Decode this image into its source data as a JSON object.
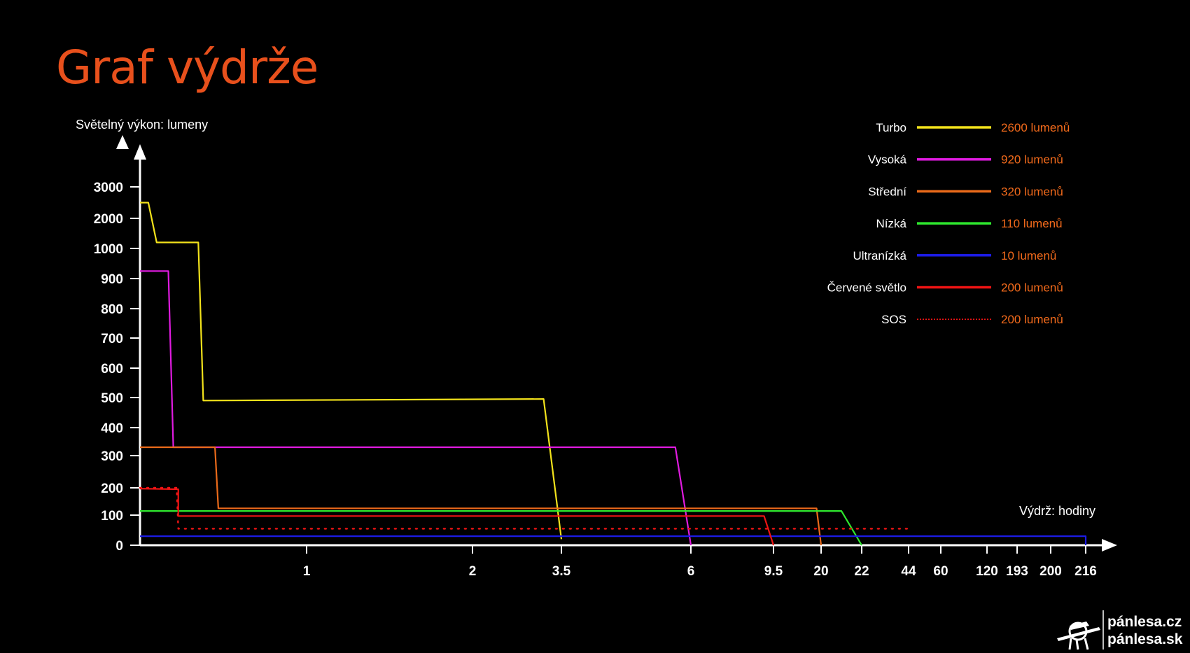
{
  "page": {
    "title": "Graf výdrže"
  },
  "chart_data": {
    "type": "line",
    "title": "Graf výdrže",
    "ylabel": "Světelný výkon: lumeny",
    "xlabel": "Výdrž: hodiny",
    "yticks": [
      "0",
      "100",
      "200",
      "300",
      "400",
      "500",
      "600",
      "700",
      "800",
      "900",
      "1000",
      "2000",
      "3000"
    ],
    "xticks": [
      "1",
      "2",
      "3.5",
      "6",
      "9.5",
      "20",
      "22",
      "44",
      "60",
      "120",
      "193",
      "200",
      "216"
    ],
    "legend_position": "top-right",
    "grid": false,
    "series": [
      {
        "name": "Turbo",
        "label": "2600 lumenů",
        "color": "#f2e21b",
        "dashed": false,
        "points": [
          [
            0,
            2500
          ],
          [
            0.05,
            2500
          ],
          [
            0.1,
            1200
          ],
          [
            0.35,
            1200
          ],
          [
            0.38,
            490
          ],
          [
            3.2,
            495
          ],
          [
            3.5,
            20
          ]
        ]
      },
      {
        "name": "Vysoká",
        "label": "920 lumenů",
        "color": "#e01be0",
        "dashed": false,
        "points": [
          [
            0,
            925
          ],
          [
            0.17,
            925
          ],
          [
            0.2,
            330
          ],
          [
            5.7,
            330
          ],
          [
            6,
            0
          ]
        ]
      },
      {
        "name": "Střední",
        "label": "320 lumenů",
        "color": "#ea6a1a",
        "dashed": false,
        "points": [
          [
            0,
            330
          ],
          [
            0.45,
            330
          ],
          [
            0.47,
            125
          ],
          [
            19,
            125
          ],
          [
            20,
            0
          ]
        ]
      },
      {
        "name": "Nízká",
        "label": "110 lumenů",
        "color": "#2ee82e",
        "dashed": false,
        "points": [
          [
            0,
            115
          ],
          [
            21,
            115
          ],
          [
            22,
            0
          ]
        ]
      },
      {
        "name": "Ultranízká",
        "label": "10 lumenů",
        "color": "#1c1ce6",
        "dashed": false,
        "points": [
          [
            0,
            30
          ],
          [
            216,
            30
          ],
          [
            216,
            0
          ]
        ]
      },
      {
        "name": "Červené světlo",
        "label": "200 lumenů",
        "color": "#f01414",
        "dashed": false,
        "points": [
          [
            0,
            197
          ],
          [
            0.23,
            195
          ],
          [
            0.23,
            97
          ],
          [
            9.1,
            97
          ],
          [
            9.5,
            0
          ]
        ]
      },
      {
        "name": "SOS",
        "label": "200 lumenů",
        "color": "#f01414",
        "dashed": true,
        "points": [
          [
            0,
            200
          ],
          [
            0.22,
            200
          ],
          [
            0.23,
            55
          ],
          [
            44,
            55
          ],
          [
            44,
            45
          ]
        ]
      }
    ]
  },
  "watermark": {
    "line1": "pánlesa.cz",
    "line2": "pánlesa.sk"
  },
  "colors": {
    "title": "#e8501c",
    "legend_value": "#f26a1b",
    "background": "#000000"
  }
}
